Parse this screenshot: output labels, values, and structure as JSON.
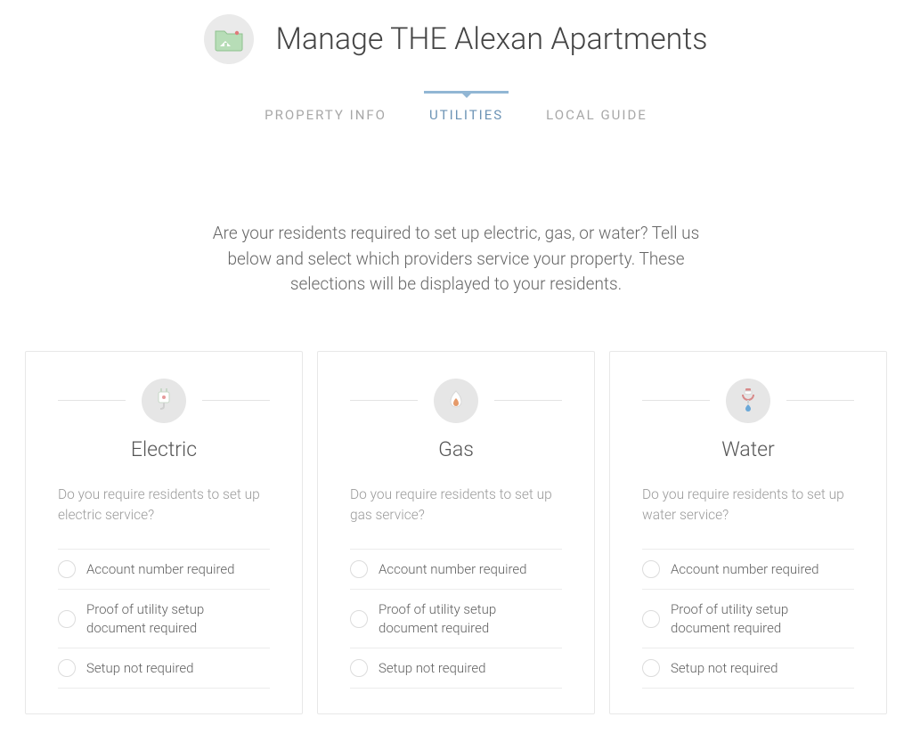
{
  "header": {
    "title": "Manage THE Alexan Apartments"
  },
  "tabs": [
    {
      "id": "property-info",
      "label": "Property Info",
      "active": false
    },
    {
      "id": "utilities",
      "label": "Utilities",
      "active": true
    },
    {
      "id": "local-guide",
      "label": "Local Guide",
      "active": false
    }
  ],
  "intro": "Are your residents required to set up electric, gas, or water? Tell us below and select which providers service your property. These selections will be displayed to your residents.",
  "cards": [
    {
      "id": "electric",
      "title": "Electric",
      "question": "Do you require residents to set up electric service?",
      "options": [
        "Account number required",
        "Proof of utility setup document required",
        "Setup not required"
      ]
    },
    {
      "id": "gas",
      "title": "Gas",
      "question": "Do you require residents to set up gas service?",
      "options": [
        "Account number required",
        "Proof of utility setup document required",
        "Setup not required"
      ]
    },
    {
      "id": "water",
      "title": "Water",
      "question": "Do you require residents to set up water service?",
      "options": [
        "Account number required",
        "Proof of utility setup document required",
        "Setup not required"
      ]
    }
  ]
}
